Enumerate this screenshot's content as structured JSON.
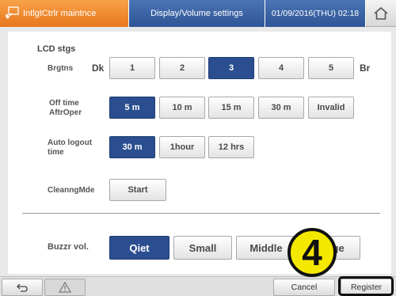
{
  "header": {
    "section_label": "IntlgtCtrlr maintnce",
    "screen_title": "Display/Volume settings",
    "datetime": "01/09/2016(THU) 02:18",
    "home_icon": "home-icon"
  },
  "lcd": {
    "title": "LCD stgs",
    "brightness": {
      "label": "Brgtns",
      "left_label": "Dk",
      "right_label": "Br",
      "options": [
        "1",
        "2",
        "3",
        "4",
        "5"
      ],
      "selected": "3"
    },
    "off_time": {
      "label_line1": "Off time",
      "label_line2": "AftrOper",
      "options": [
        "5 m",
        "10 m",
        "15 m",
        "30 m",
        "Invalid"
      ],
      "selected": "5 m"
    },
    "auto_logout": {
      "label_line1": "Auto logout",
      "label_line2": "time",
      "options": [
        "30 m",
        "1hour",
        "12 hrs"
      ],
      "selected": "30 m"
    },
    "cleaning": {
      "label": "CleanngMde",
      "button": "Start"
    }
  },
  "buzzer": {
    "label": "Buzzr vol.",
    "options": [
      "Qiet",
      "Small",
      "Middle",
      "Large"
    ],
    "selected": "Qiet"
  },
  "footer": {
    "back_icon": "back-arrow-icon",
    "warning_icon": "warning-icon",
    "cancel": "Cancel",
    "register": "Register"
  },
  "annotation": {
    "step_number": "4"
  },
  "colors": {
    "header_orange": "#e8761c",
    "header_blue": "#2e5596",
    "selected_button": "#2a4e8f",
    "step_yellow": "#f5e800"
  }
}
